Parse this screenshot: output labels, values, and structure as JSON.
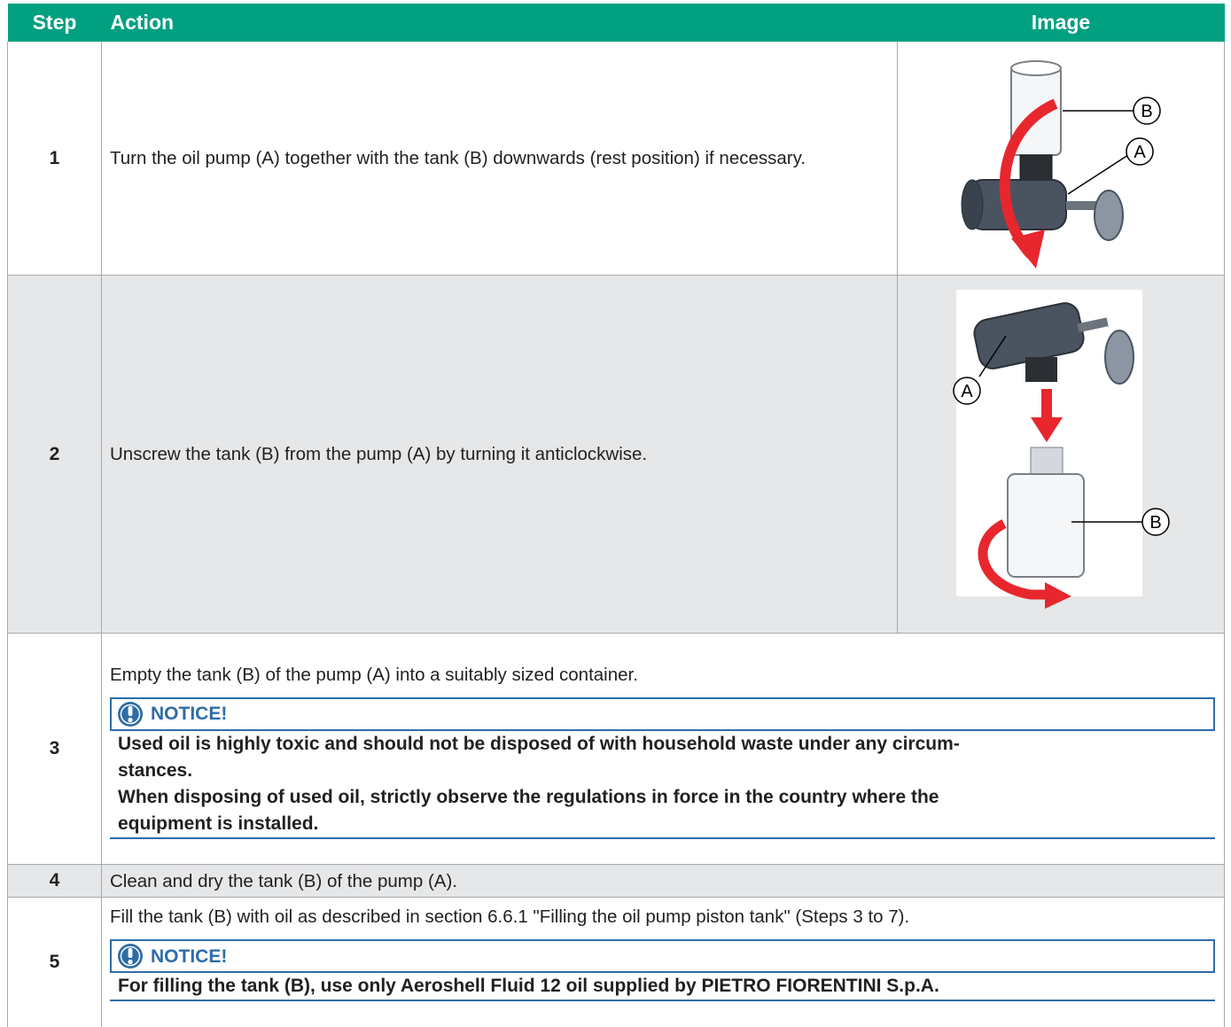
{
  "headers": {
    "step": "Step",
    "action": "Action",
    "image": "Image"
  },
  "rows": [
    {
      "step": "1",
      "action": "Turn the oil pump (A) together with the tank (B) downwards (rest position) if necessary."
    },
    {
      "step": "2",
      "action": "Unscrew the tank (B) from the pump (A) by turning it anticlockwise."
    },
    {
      "step": "3",
      "action": "Empty the tank (B) of the pump (A) into a suitably sized container.",
      "notice_title": "NOTICE!",
      "notice_lines": [
        "Used oil is highly toxic and should not be disposed of with household waste under any circum-",
        "stances.",
        "When disposing of used oil, strictly observe the regulations in force in the country where the",
        "equipment is installed."
      ]
    },
    {
      "step": "4",
      "action": "Clean and dry the tank (B) of the pump (A)."
    },
    {
      "step": "5",
      "action": "Fill the tank (B) with oil as described in section 6.6.1 \"Filling the oil pump piston tank\" (Steps 3 to 7).",
      "notice_title": "NOTICE!",
      "notice_lines": [
        "For filling the tank (B), use only Aeroshell Fluid 12 oil supplied by PIETRO FIORENTINI S.p.A."
      ]
    }
  ],
  "figure_labels": {
    "a": "A",
    "b": "B"
  },
  "colors": {
    "header": "#00a080",
    "notice": "#2e6ca7",
    "arrow": "#e8262d",
    "shade": "#e6e7e8"
  },
  "icons": {
    "notice": "exclamation-circle-icon",
    "rotate": "curved-arrow-icon",
    "down": "down-arrow-icon"
  }
}
